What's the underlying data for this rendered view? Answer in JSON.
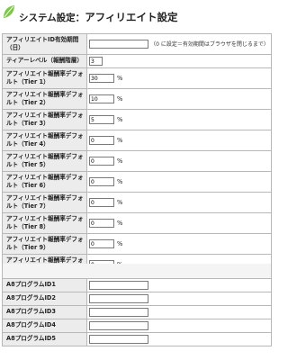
{
  "page": {
    "title_prefix": "システム設定：",
    "title_main": "アフィリエイト設定",
    "accent_color": "#7ac943"
  },
  "settings": {
    "validity_days": {
      "label": "アフィリエイトID有効期間（日）",
      "value": "",
      "note": "（0 に設定＝有効期間はブラウザを閉じるまで）"
    },
    "tier_level": {
      "label": "ティアーレベル（報酬階層）",
      "value": "3"
    },
    "rates": [
      {
        "label": "アフィリエイト報酬率デフォルト（Tier 1）",
        "value": "30",
        "unit": "%"
      },
      {
        "label": "アフィリエイト報酬率デフォルト（Tier 2）",
        "value": "10",
        "unit": "%"
      },
      {
        "label": "アフィリエイト報酬率デフォルト（Tier 3）",
        "value": "5",
        "unit": "%"
      },
      {
        "label": "アフィリエイト報酬率デフォルト（Tier 4）",
        "value": "0",
        "unit": "%"
      },
      {
        "label": "アフィリエイト報酬率デフォルト（Tier 5）",
        "value": "0",
        "unit": "%"
      },
      {
        "label": "アフィリエイト報酬率デフォルト（Tier 6）",
        "value": "0",
        "unit": "%"
      },
      {
        "label": "アフィリエイト報酬率デフォルト（Tier 7）",
        "value": "0",
        "unit": "%"
      },
      {
        "label": "アフィリエイト報酬率デフォルト（Tier 8）",
        "value": "0",
        "unit": "%"
      },
      {
        "label": "アフィリエイト報酬率デフォルト（Tier 9）",
        "value": "0",
        "unit": "%"
      },
      {
        "label": "アフィリエイト報酬率デフォルト（Tier 10）",
        "value": "0",
        "unit": "%"
      }
    ]
  },
  "a8": [
    {
      "label": "A8プログラムID1",
      "value": ""
    },
    {
      "label": "A8プログラムID2",
      "value": ""
    },
    {
      "label": "A8プログラムID3",
      "value": ""
    },
    {
      "label": "A8プログラムID4",
      "value": ""
    },
    {
      "label": "A8プログラムID5",
      "value": ""
    }
  ]
}
